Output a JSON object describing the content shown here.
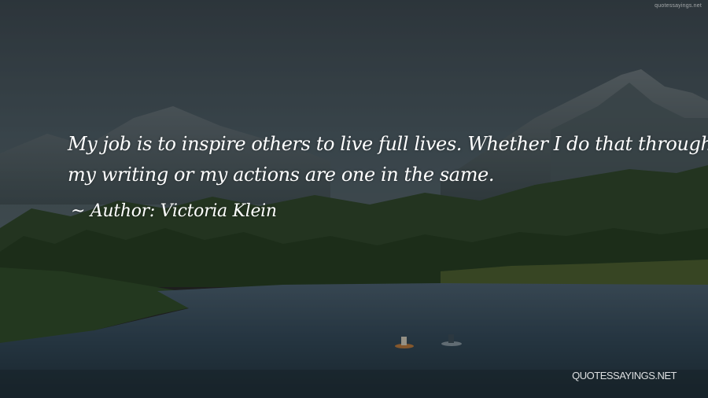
{
  "quote": {
    "lines": [
      "My job is to inspire others to live full lives. Whether I do that through",
      "my writing or my actions are one in the same."
    ]
  },
  "author": {
    "line": "~ Author: Victoria Klein"
  },
  "watermarks": {
    "top_right": "quotessayings.net",
    "bottom_right": "QUOTESSAYINGS.NET"
  },
  "colors": {
    "text": "#ffffff",
    "sky": "#3d4c56",
    "water": "#2b4052",
    "forest": "#223a1e"
  }
}
